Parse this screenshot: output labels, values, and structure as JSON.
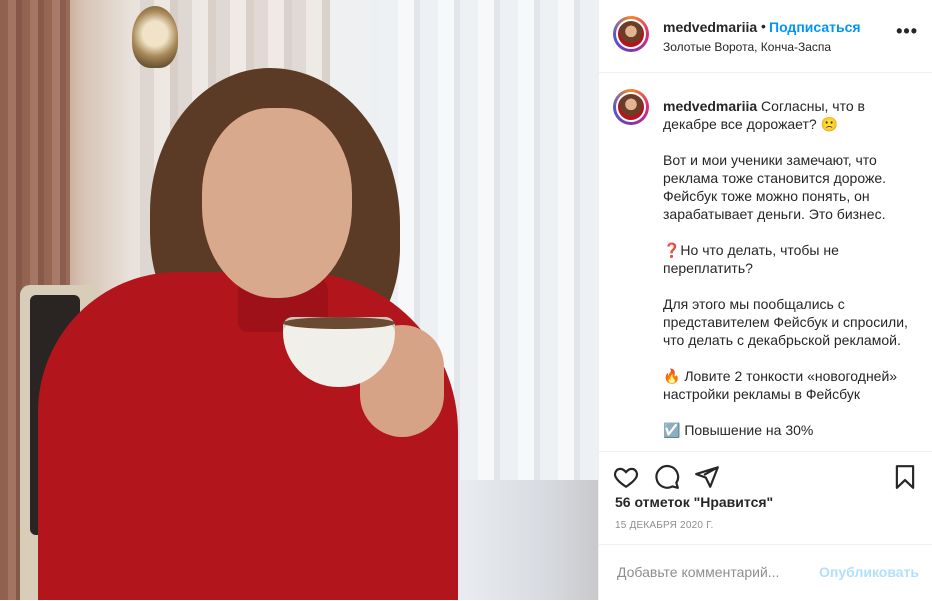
{
  "post": {
    "username": "medvedmariia",
    "follow_label": "Подписаться",
    "location": "Золотые Ворота, Конча-Заспа",
    "more_label": "•••",
    "caption": {
      "author": "medvedmariia",
      "text": " Согласны, что в декабре все дорожает? 🙁\n\nВот и мои ученики замечают, что реклама тоже становится дороже. Фейсбук тоже можно понять, он зарабатывает деньги. Это бизнес.\n\n❓Но что делать, чтобы не переплатить?\n\nДля этого мы пообщались с представителем Фейсбук и спросили, что делать с декабрьской рекламой.\n\n🔥 Ловите 2 тонкости «новогодней» настройки рекламы в Фейсбук\n\n☑️ Повышение на 30%"
    },
    "likes": "56 отметок \"Нравится\"",
    "date": "15 ДЕКАБРЯ 2020 Г.",
    "comment": {
      "placeholder": "Добавьте комментарий...",
      "post_label": "Опубликовать"
    }
  },
  "icons": {
    "like": "heart-icon",
    "comment": "comment-icon",
    "share": "paper-plane-icon",
    "save": "bookmark-icon",
    "more": "more-options-icon"
  },
  "colors": {
    "accent": "#0095f6",
    "post_disabled": "#b2dffc",
    "muted": "#8e8e8e"
  }
}
